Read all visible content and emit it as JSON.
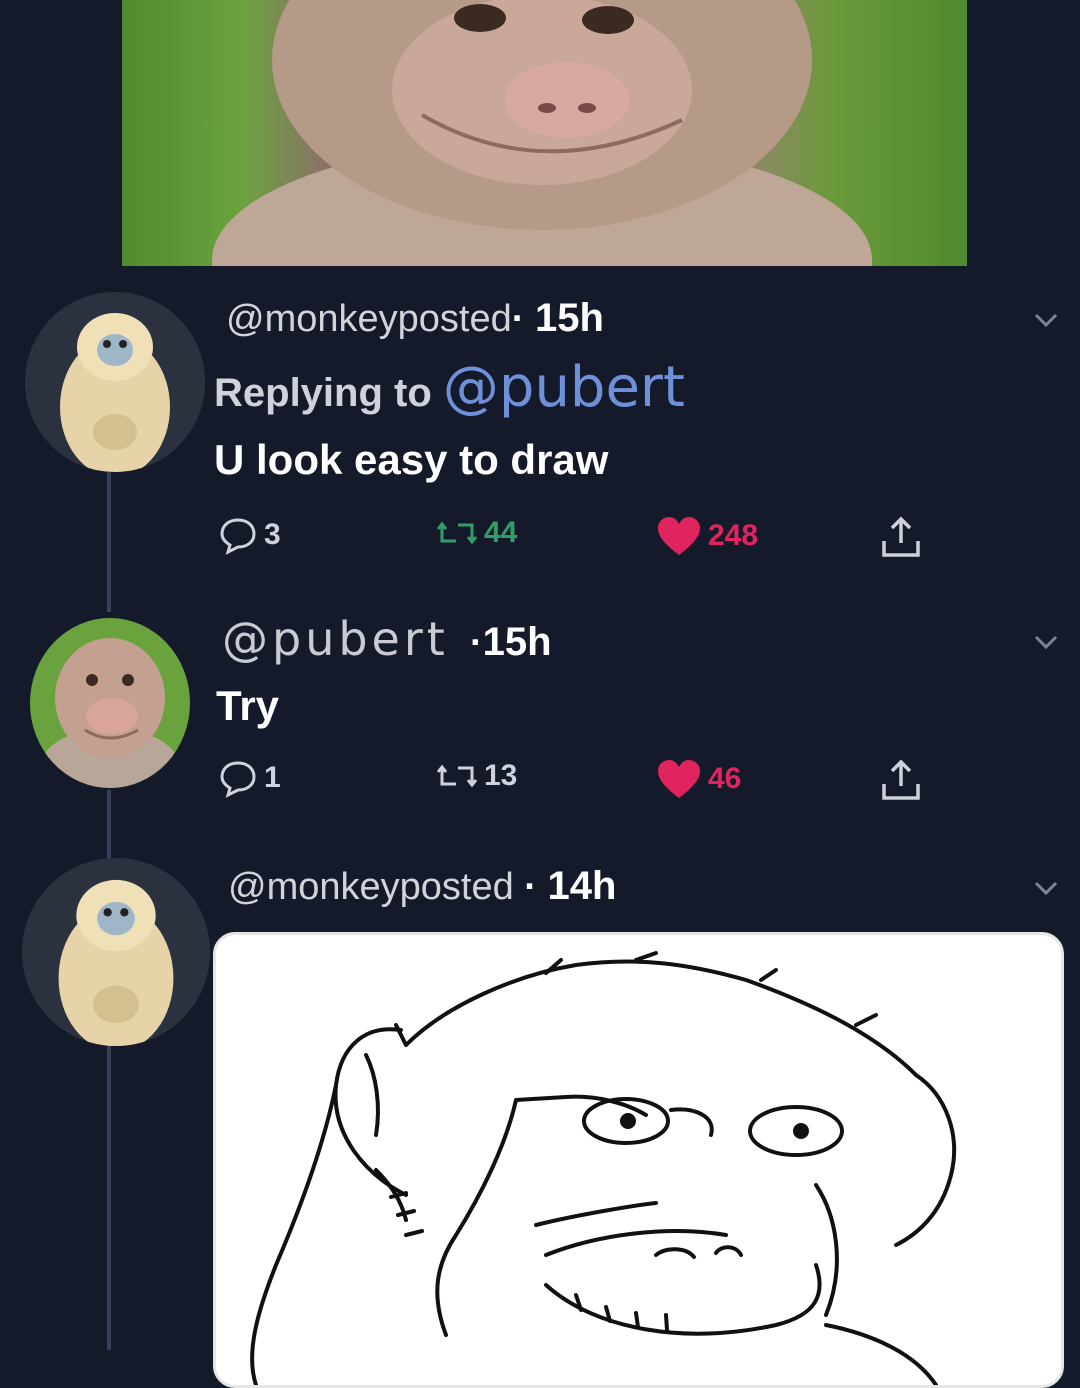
{
  "tweets": [
    {
      "handle": "@monkeyposted",
      "separator": "·",
      "time": "15h",
      "replying_prefix": "Replying to ",
      "replying_mention": "@pubert",
      "text": "U look easy to draw",
      "replies": "3",
      "retweets": "44",
      "likes": "248"
    },
    {
      "handle": "@pubert",
      "separator": "·",
      "time": "15h",
      "text": "Try",
      "replies": "1",
      "retweets": "13",
      "likes": "46"
    },
    {
      "handle": "@monkeyposted",
      "separator": "·",
      "time": "14h"
    }
  ],
  "icons": [
    "comment-icon",
    "retweet-icon",
    "heart-icon",
    "share-icon",
    "chevron-down-icon"
  ],
  "colors": {
    "background": "#151a2b",
    "mention": "#6f8fd8",
    "retweet": "#2f9e6a",
    "like": "#e0245e",
    "muted": "#cfd2da"
  }
}
